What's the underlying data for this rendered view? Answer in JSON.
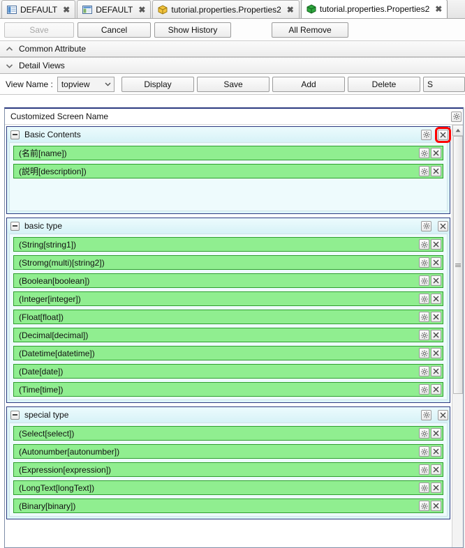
{
  "tabs": [
    {
      "label": "DEFAULT",
      "icon": "layout-left-panel-icon",
      "active": false,
      "close": "✖"
    },
    {
      "label": "DEFAULT",
      "icon": "layout-grid-icon",
      "active": false,
      "close": "✖"
    },
    {
      "label": "tutorial.properties.Properties2",
      "icon": "yellow-box-icon",
      "active": false,
      "close": "✖"
    },
    {
      "label": "tutorial.properties.Properties2",
      "icon": "green-box-icon",
      "active": true,
      "close": "✖"
    }
  ],
  "toolbar": {
    "save_label": "Save",
    "cancel_label": "Cancel",
    "show_history_label": "Show History",
    "all_remove_label": "All Remove"
  },
  "accordions": [
    {
      "label": "Common Attribute",
      "state": "collapsed",
      "chevron": "chevron-up-icon"
    },
    {
      "label": "Detail Views",
      "state": "expanded",
      "chevron": "chevron-down-icon"
    }
  ],
  "view_row": {
    "label": "View Name :",
    "selected": "topview",
    "options": [
      "topview"
    ],
    "buttons": [
      "Display",
      "Save",
      "Add",
      "Delete",
      "S"
    ]
  },
  "panel": {
    "title": "Customized Screen Name",
    "gear": "gear-icon"
  },
  "groups": [
    {
      "title": "Basic Contents",
      "collapse": "minus-icon",
      "gear": "gear-icon",
      "close": "close-icon",
      "close_highlighted": true,
      "extra_height": 42,
      "fields": [
        {
          "label": "(名前[name])",
          "gear": "gear-icon",
          "close": "close-icon"
        },
        {
          "label": "(説明[description])",
          "gear": "gear-icon",
          "close": "close-icon"
        }
      ]
    },
    {
      "title": "basic type",
      "collapse": "minus-icon",
      "gear": "gear-icon",
      "close": "close-icon",
      "close_highlighted": false,
      "extra_height": 0,
      "fields": [
        {
          "label": "(String[string1])",
          "gear": "gear-icon",
          "close": "close-icon"
        },
        {
          "label": "(Stromg(multi)[string2])",
          "gear": "gear-icon",
          "close": "close-icon"
        },
        {
          "label": "(Boolean[boolean])",
          "gear": "gear-icon",
          "close": "close-icon"
        },
        {
          "label": "(Integer[integer])",
          "gear": "gear-icon",
          "close": "close-icon"
        },
        {
          "label": "(Float[float])",
          "gear": "gear-icon",
          "close": "close-icon"
        },
        {
          "label": "(Decimal[decimal])",
          "gear": "gear-icon",
          "close": "close-icon"
        },
        {
          "label": "(Datetime[datetime])",
          "gear": "gear-icon",
          "close": "close-icon"
        },
        {
          "label": "(Date[date])",
          "gear": "gear-icon",
          "close": "close-icon"
        },
        {
          "label": "(Time[time])",
          "gear": "gear-icon",
          "close": "close-icon"
        }
      ]
    },
    {
      "title": "special type",
      "collapse": "minus-icon",
      "gear": "gear-icon",
      "close": "close-icon",
      "close_highlighted": false,
      "extra_height": 0,
      "fields": [
        {
          "label": "(Select[select])",
          "gear": "gear-icon",
          "close": "close-icon"
        },
        {
          "label": "(Autonumber[autonumber])",
          "gear": "gear-icon",
          "close": "close-icon"
        },
        {
          "label": "(Expression[expression])",
          "gear": "gear-icon",
          "close": "close-icon"
        },
        {
          "label": "(LongText[longText])",
          "gear": "gear-icon",
          "close": "close-icon"
        },
        {
          "label": "(Binary[binary])",
          "gear": "gear-icon",
          "close": "close-icon"
        }
      ]
    }
  ],
  "colors": {
    "field_green": "#90ee90",
    "field_border": "#2f9e2f",
    "group_cyan": "#dff6f9",
    "panel_border": "#2b3a80",
    "highlight_red": "#ff0000"
  }
}
